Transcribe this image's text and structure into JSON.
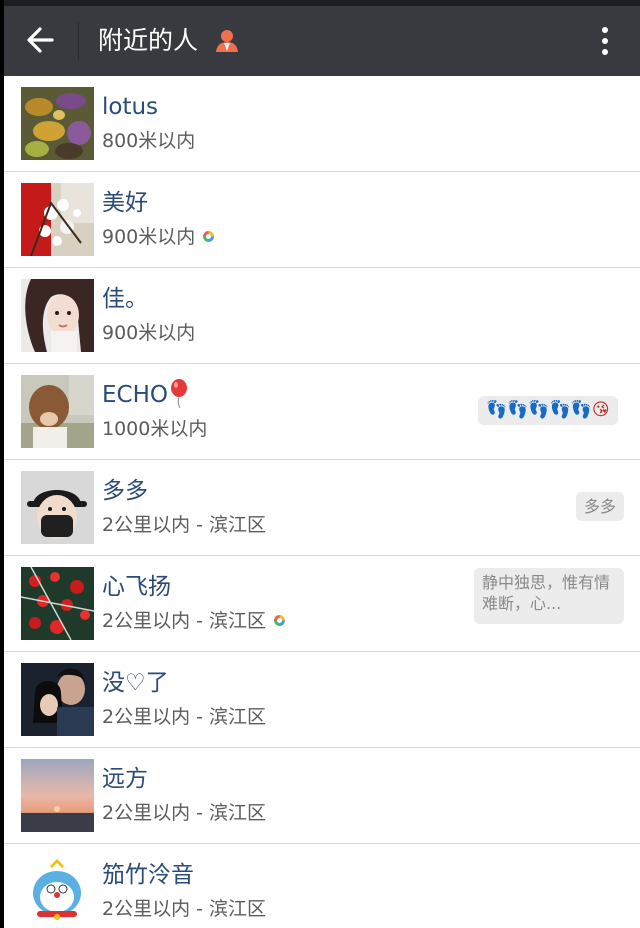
{
  "header": {
    "title": "附近的人"
  },
  "people": [
    {
      "name": "lotus",
      "distance": "800米以内",
      "dot": false,
      "signature": ""
    },
    {
      "name": "美好",
      "distance": "900米以内",
      "dot": true,
      "signature": ""
    },
    {
      "name": "佳。",
      "distance": "900米以内",
      "dot": false,
      "signature": ""
    },
    {
      "name": "ECHO",
      "distance": "1000米以内",
      "dot": false,
      "signature": "👣👣👣👣👣😘"
    },
    {
      "name": "多多",
      "distance": "2公里以内 - 滨江区",
      "dot": false,
      "signature": "多多"
    },
    {
      "name": "心飞扬",
      "distance": "2公里以内 - 滨江区",
      "dot": true,
      "signature": "静中独思，惟有情难断，心..."
    },
    {
      "name": "没♡了",
      "distance": "2公里以内 - 滨江区",
      "dot": false,
      "signature": ""
    },
    {
      "name": "远方",
      "distance": "2公里以内 - 滨江区",
      "dot": false,
      "signature": ""
    },
    {
      "name": "笳竹泠音",
      "distance": "2公里以内 - 滨江区",
      "dot": false,
      "signature": ""
    }
  ],
  "colors": {
    "header_bg": "#393a3f",
    "name_text": "#2a4a78",
    "dist_text": "#5c5c5c",
    "bubble_bg": "#ececec"
  }
}
